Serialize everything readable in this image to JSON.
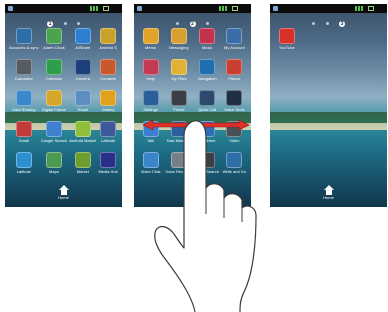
{
  "screens": [
    {
      "dots_active": "1",
      "apps": [
        {
          "label": "Accounts & sync",
          "color": "#2f6fa8"
        },
        {
          "label": "Alarm Clock",
          "color": "#4aa34f"
        },
        {
          "label": "AllShare",
          "color": "#2c7fd1"
        },
        {
          "label": "Android S",
          "color": "#caa12a"
        },
        {
          "label": "Calculator",
          "color": "#555b63"
        },
        {
          "label": "Calendar",
          "color": "#2e9e4a"
        },
        {
          "label": "Camera",
          "color": "#1d3f7a"
        },
        {
          "label": "Contacts",
          "color": "#c65a2c"
        },
        {
          "label": "Data Sharing",
          "color": "#3a88c9"
        },
        {
          "label": "Digital Frame",
          "color": "#d6a62b"
        },
        {
          "label": "Email",
          "color": "#5c8ec2"
        },
        {
          "label": "Gallery",
          "color": "#e0a11f"
        },
        {
          "label": "Gmail",
          "color": "#c23b3b"
        },
        {
          "label": "Google Search",
          "color": "#3f7fd0"
        },
        {
          "label": "Android Market",
          "color": "#8fbf3a"
        },
        {
          "label": "Latitude",
          "color": "#3c5a9a"
        },
        {
          "label": "Latitude",
          "color": "#2b8fd0"
        },
        {
          "label": "Maps",
          "color": "#4c9a52"
        },
        {
          "label": "Market",
          "color": "#6c9d2f"
        },
        {
          "label": "Media Hub",
          "color": "#2a2f8a"
        }
      ],
      "home_label": "Home"
    },
    {
      "dots_active": "2",
      "apps": [
        {
          "label": "Memo",
          "color": "#e2a32a"
        },
        {
          "label": "Messaging",
          "color": "#d8a031"
        },
        {
          "label": "Music",
          "color": "#c2324a"
        },
        {
          "label": "My Account",
          "color": "#3a6ea8"
        },
        {
          "label": "Help",
          "color": "#c23b55"
        },
        {
          "label": "My Files",
          "color": "#e0b037"
        },
        {
          "label": "Navigation",
          "color": "#1f6fb0"
        },
        {
          "label": "Places",
          "color": "#c84032"
        },
        {
          "label": "Settings",
          "color": "#2a5f9a"
        },
        {
          "label": "Phone",
          "color": "#3a3f46"
        },
        {
          "label": "Quick Call",
          "color": "#2b4a6e"
        },
        {
          "label": "Voice Tools",
          "color": "#1f2f44"
        },
        {
          "label": "Talk",
          "color": "#3a7fd0"
        },
        {
          "label": "Task Manager",
          "color": "#2f5f9a"
        },
        {
          "label": "Thinkfree",
          "color": "#2f6fb8"
        },
        {
          "label": "Video",
          "color": "#4a4f56"
        },
        {
          "label": "Video Chat",
          "color": "#3a86c8"
        },
        {
          "label": "Voice Recorder",
          "color": "#7a7f86"
        },
        {
          "label": "Voice Search",
          "color": "#3a3f46"
        },
        {
          "label": "Write and Go",
          "color": "#2f6fa8"
        }
      ],
      "home_label": ""
    },
    {
      "dots_active": "3",
      "apps": [
        {
          "label": "YouTube",
          "color": "#d8302a"
        }
      ],
      "home_label": "Home"
    }
  ],
  "colors": {
    "arrow": "#e0302a",
    "hand_fill": "#ffffff",
    "hand_stroke": "#3a3a3a"
  }
}
